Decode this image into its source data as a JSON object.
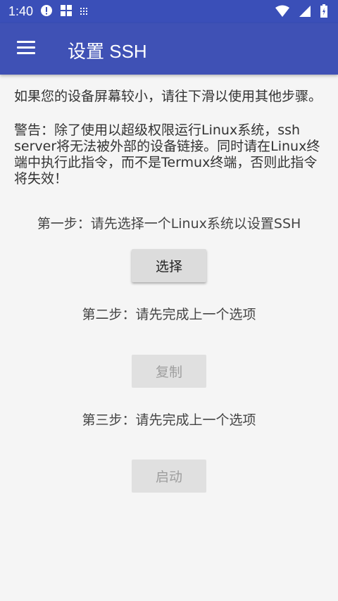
{
  "status_bar": {
    "time": "1:40",
    "left_icons": [
      "alert-icon",
      "windows-icon",
      "grid-icon"
    ],
    "right_icons": [
      "wifi-icon",
      "signal-icon",
      "battery-icon"
    ]
  },
  "app_bar": {
    "title": "设置 SSH",
    "menu_icon": "hamburger-menu-icon",
    "color": "#3f51b5"
  },
  "content": {
    "intro": "如果您的设备屏幕较小，请往下滑以使用其他步骤。",
    "warning": "警告：除了使用以超级权限运行Linux系统，ssh server将无法被外部的设备链接。同时请在Linux终端中执行此指令，而不是Termux终端，否则此指令将失效！",
    "steps": [
      {
        "label": "第一步：请先选择一个Linux系统以设置SSH",
        "button": "选择",
        "enabled": true
      },
      {
        "label": "第二步：请先完成上一个选项",
        "button": "复制",
        "enabled": false
      },
      {
        "label": "第三步：请先完成上一个选项",
        "button": "启动",
        "enabled": false
      }
    ]
  }
}
